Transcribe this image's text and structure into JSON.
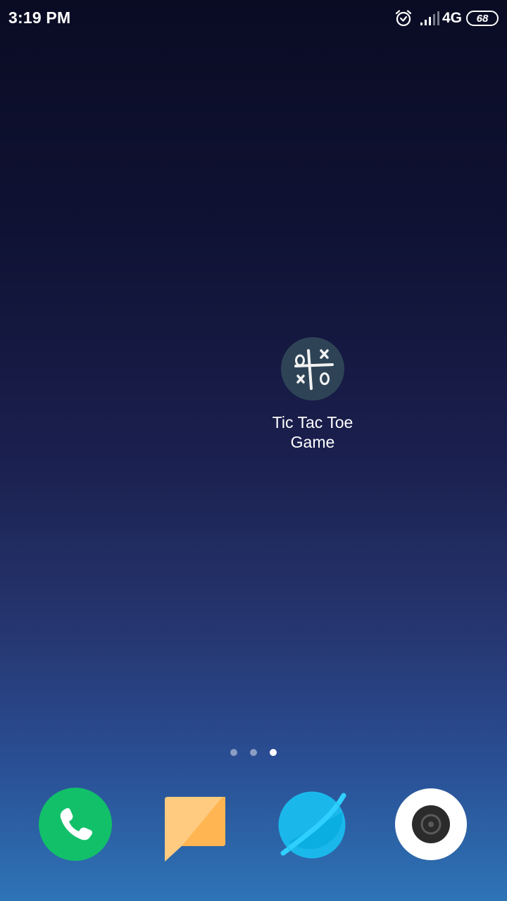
{
  "status_bar": {
    "time": "3:19 PM",
    "network": "4G",
    "battery_level": "68",
    "icons": [
      "alarm-icon",
      "signal-icon",
      "battery-icon"
    ]
  },
  "home_screen": {
    "app": {
      "label_line1": "Tic Tac Toe",
      "label_line2": "Game",
      "icon": "tic-tac-toe-icon",
      "icon_color": "#2e4456"
    },
    "page_indicator": {
      "page_count": 3,
      "active_page": 3
    }
  },
  "dock": {
    "apps": [
      {
        "icon": "phone-icon",
        "color": "#12c06a"
      },
      {
        "icon": "messages-icon",
        "color": "#ffb652"
      },
      {
        "icon": "browser-icon",
        "color": "#1ab8ea"
      },
      {
        "icon": "camera-icon",
        "color": "#ffffff"
      }
    ]
  }
}
